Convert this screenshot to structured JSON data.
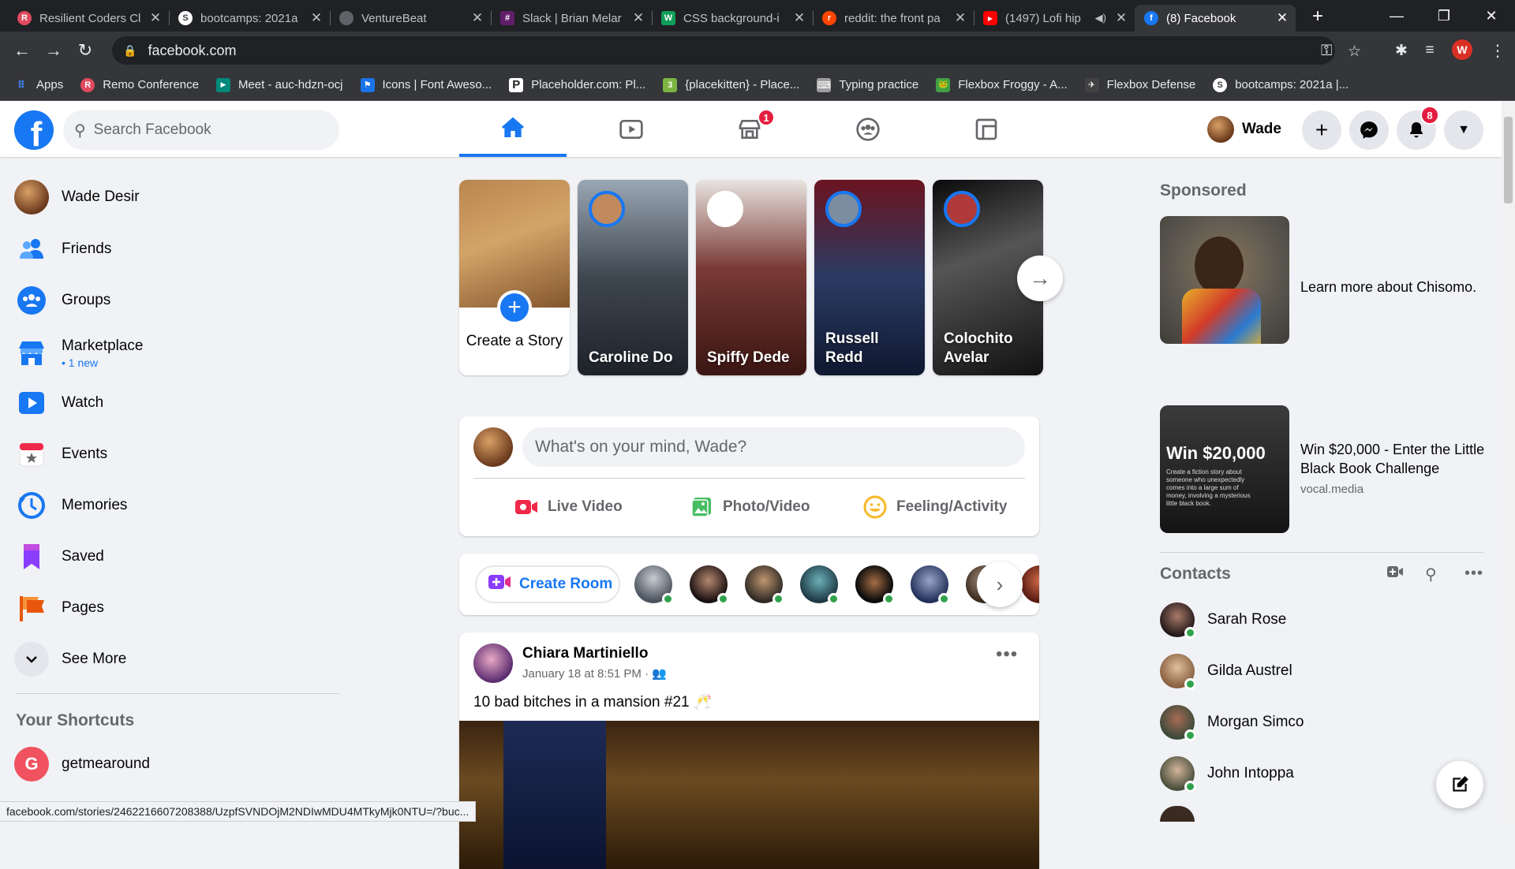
{
  "browser": {
    "tabs": [
      {
        "title": "Resilient Coders Cl",
        "color": "#e04a5f",
        "glyph": "R"
      },
      {
        "title": "bootcamps: 2021a",
        "color": "#3c4043",
        "glyph": "S"
      },
      {
        "title": "VentureBeat",
        "color": "#5f6368",
        "glyph": ""
      },
      {
        "title": "Slack | Brian Melar",
        "color": "#611f69",
        "glyph": "#"
      },
      {
        "title": "CSS background-i",
        "color": "#0f9d58",
        "glyph": "W"
      },
      {
        "title": "reddit: the front pa",
        "color": "#ff4500",
        "glyph": "r"
      },
      {
        "title": "(1497) Lofi hip",
        "color": "#ff0000",
        "glyph": "▶"
      },
      {
        "title": "(8) Facebook",
        "color": "#1877f2",
        "glyph": "f"
      }
    ],
    "url": "facebook.com",
    "profile_initial": "W",
    "bookmarks": [
      {
        "label": "Apps",
        "color": "#4285f4",
        "glyph": "⋮⋮"
      },
      {
        "label": "Remo Conference",
        "color": "#e04a5f",
        "glyph": "R"
      },
      {
        "label": "Meet - auc-hdzn-ocj",
        "color": "#00897b",
        "glyph": "▶"
      },
      {
        "label": "Icons | Font Aweso...",
        "color": "#1a73e8",
        "glyph": "⚑"
      },
      {
        "label": "Placeholder.com: Pl...",
        "color": "#202124",
        "glyph": "P"
      },
      {
        "label": "{placekitten} - Place...",
        "color": "#7cb342",
        "glyph": "3"
      },
      {
        "label": "Typing practice",
        "color": "#9e9e9e",
        "glyph": "⌨"
      },
      {
        "label": "Flexbox Froggy - A...",
        "color": "#43a047",
        "glyph": "🐸"
      },
      {
        "label": "Flexbox Defense",
        "color": "#424242",
        "glyph": "✈"
      },
      {
        "label": "bootcamps: 2021a |...",
        "color": "#3c4043",
        "glyph": "S"
      }
    ],
    "status_url": "facebook.com/stories/2462216607208388/UzpfSVNDOjM2NDIwMDU4MTkyMjk0NTU=/?buc..."
  },
  "header": {
    "search_placeholder": "Search Facebook",
    "marketplace_badge": "1",
    "user_name": "Wade",
    "notifications_badge": "8"
  },
  "sidebar": {
    "items": [
      {
        "label": "Wade Desir"
      },
      {
        "label": "Friends"
      },
      {
        "label": "Groups"
      },
      {
        "label": "Marketplace",
        "sub": "• 1 new"
      },
      {
        "label": "Watch"
      },
      {
        "label": "Events"
      },
      {
        "label": "Memories"
      },
      {
        "label": "Saved"
      },
      {
        "label": "Pages"
      },
      {
        "label": "See More"
      }
    ],
    "shortcuts_title": "Your Shortcuts",
    "shortcuts": [
      {
        "label": "getmearound",
        "initial": "G"
      }
    ]
  },
  "stories": {
    "create_label": "Create a Story",
    "items": [
      {
        "name": "Caroline Do"
      },
      {
        "name": "Spiffy Dede"
      },
      {
        "name": "Russell Redd"
      },
      {
        "name": "Colochito Avelar"
      }
    ]
  },
  "composer": {
    "placeholder": "What's on your mind, Wade?",
    "actions": [
      {
        "label": "Live Video",
        "color": "#f02849"
      },
      {
        "label": "Photo/Video",
        "color": "#45bd62"
      },
      {
        "label": "Feeling/Activity",
        "color": "#f7b928"
      }
    ]
  },
  "rooms": {
    "create_label": "Create Room"
  },
  "post": {
    "author": "Chiara Martiniello",
    "time": "January 18 at 8:51 PM · ",
    "text": "10 bad bitches in a mansion #21 🥂"
  },
  "right": {
    "sponsored_title": "Sponsored",
    "ads": [
      {
        "text": "Learn more about Chisomo.",
        "source": ""
      },
      {
        "text": "Win $20,000 - Enter the Little Black Book Challenge",
        "source": "vocal.media",
        "img_headline": "Win $20,000",
        "img_caption": "Create a fiction story about someone who unexpectedly comes into a large sum of money, involving a mysterious little black book."
      }
    ],
    "contacts_title": "Contacts",
    "contacts": [
      {
        "name": "Sarah Rose"
      },
      {
        "name": "Gilda Austrel"
      },
      {
        "name": "Morgan Simco"
      },
      {
        "name": "John Intoppa"
      }
    ]
  }
}
